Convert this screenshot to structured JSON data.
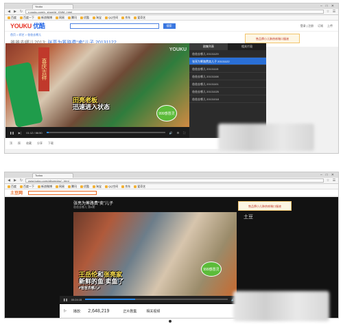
{
  "shot1": {
    "tab_title": "Youku",
    "url": "v.youku.com/v_show/id_XNjM...html",
    "bookmarks": [
      "百度",
      "百度一下",
      "新浪微博",
      "网易",
      "腾讯",
      "优酷",
      "淘宝",
      "QQ空间",
      "京东",
      "爱奇艺"
    ],
    "logo_main": "YOUKU",
    "logo_cn": "优酷",
    "search_btn": "搜索",
    "user_links": [
      "登录 | 注册",
      "订阅",
      "上传"
    ],
    "breadcrumb": "首页 > 综艺 > 爸爸去哪儿",
    "title_prefix": "爸爸去哪儿2013:",
    "title_main": "张亮为筹路费“卖”儿子 20131122",
    "ad_text": "售品牌小儿肺热咳喘口服液",
    "couplet": "喜庆吉祥",
    "caption_line1": "田亮老板",
    "caption_line2": "迅速进入状态",
    "watermark": "YOUKU",
    "sponsor": "999感冒灵",
    "time": "01:12 / 86:50",
    "progress": 0.02,
    "side_tabs": [
      "剧集列表",
      "相关片段"
    ],
    "side_items": [
      "爸爸去哪儿 20131129",
      "张亮为筹路费卖儿子 20131122",
      "爸爸去哪儿 20131115",
      "爸爸去哪儿 20131108",
      "爸爸去哪儿 20131101",
      "爸爸去哪儿 20131025",
      "爸爸去哪儿 20131018"
    ],
    "under_items": [
      "顶",
      "踩",
      "收藏",
      "分享",
      "下载"
    ],
    "view_count": "2778万"
  },
  "shot2": {
    "tab_title": "Tudou",
    "url": "www.tudou.com/albumplay/...html",
    "bookmarks": [
      "百度",
      "百度一下",
      "新浪微博",
      "网易",
      "腾讯",
      "优酷",
      "淘宝",
      "QQ空间",
      "京东",
      "爱奇艺"
    ],
    "logo": "土豆网",
    "stage_title": "张亮为筹路费“卖”儿子",
    "stage_sub": "爸爸去哪儿 第8期",
    "ad_text": "售品牌小儿肺热咳喘口服液",
    "watermark": "土豆",
    "caption_name1": "王岳伦",
    "caption_mid": "和",
    "caption_name2": "张亮家",
    "caption_line2": "新鲜的鱼 卖鱼了",
    "caption_small": "#爸爸去哪儿#",
    "sponsor": "999感冒灵",
    "time": "00:24:15",
    "progress": 0.35,
    "views_label": "播放:",
    "views": "2,648,219",
    "bottom_tabs": [
      "正片剧集",
      "相关视频"
    ]
  }
}
